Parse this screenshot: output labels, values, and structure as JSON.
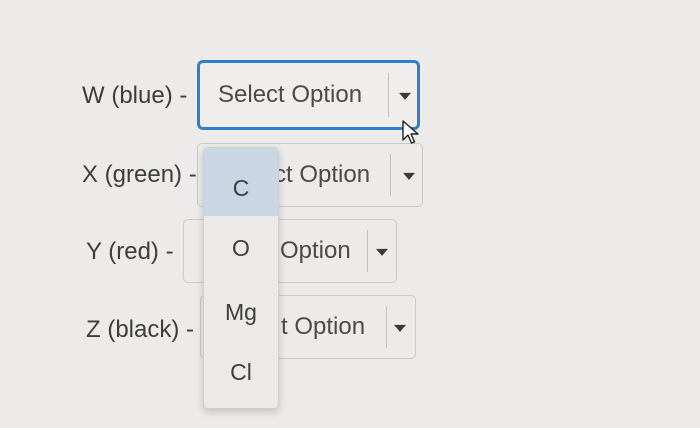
{
  "rows": [
    {
      "label": "W (blue) -",
      "select_value": "Select Option"
    },
    {
      "label": "X (green) -",
      "select_value": "ct Option"
    },
    {
      "label": "Y (red) -",
      "select_value": "Option"
    },
    {
      "label": "Z (black) -",
      "select_value": "t Option"
    }
  ],
  "dropdown": {
    "options": [
      "C",
      "O",
      "Mg",
      "Cl"
    ],
    "highlighted": "C"
  },
  "colors": {
    "focus_border": "#2f80c8",
    "highlight_bg": "#c9d6e4"
  }
}
